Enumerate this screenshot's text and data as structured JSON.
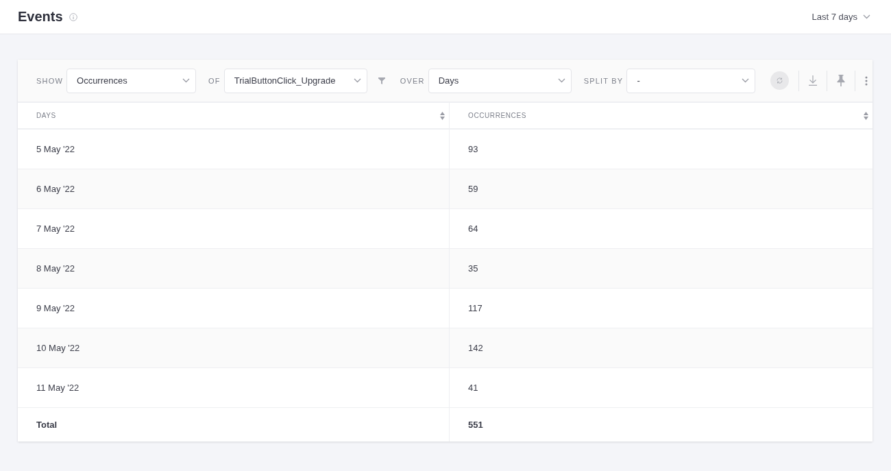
{
  "header": {
    "title": "Events",
    "range": "Last 7 days"
  },
  "toolbar": {
    "filters": [
      {
        "label": "SHOW",
        "value": "Occurrences",
        "filter_icon": false
      },
      {
        "label": "OF",
        "value": "TrialButtonClick_Upgrade",
        "filter_icon": true
      },
      {
        "label": "OVER",
        "value": "Days",
        "filter_icon": false
      },
      {
        "label": "SPLIT BY",
        "value": "-",
        "filter_icon": false
      }
    ]
  },
  "table": {
    "columns": [
      "DAYS",
      "OCCURRENCES"
    ],
    "rows": [
      [
        "5 May '22",
        "93"
      ],
      [
        "6 May '22",
        "59"
      ],
      [
        "7 May '22",
        "64"
      ],
      [
        "8 May '22",
        "35"
      ],
      [
        "9 May '22",
        "117"
      ],
      [
        "10 May '22",
        "142"
      ],
      [
        "11 May '22",
        "41"
      ]
    ],
    "total": [
      "Total",
      "551"
    ]
  }
}
